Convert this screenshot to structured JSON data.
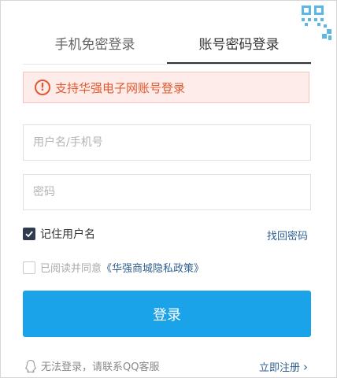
{
  "tabs": {
    "sms_login": "手机免密登录",
    "password_login": "账号密码登录"
  },
  "notice": {
    "icon": "!",
    "text": "支持华强电子网账号登录"
  },
  "form": {
    "username_placeholder": "用户名/手机号",
    "username_value": "",
    "password_placeholder": "密码",
    "password_value": "",
    "remember_label": "记住用户名",
    "forgot_link": "找回密码",
    "agree_text": "已阅读并同意",
    "agree_link": "《华强商城隐私政策》",
    "login_button": "登录"
  },
  "footer": {
    "help_text": "无法登录，请联系QQ客服",
    "register_link": "立即注册",
    "register_arrow": "›"
  },
  "colors": {
    "primary_button": "#1aa3e8",
    "notice_text": "#e4582e",
    "notice_bg": "#fdecea",
    "link": "#2f5f8f",
    "checkbox_checked": "#2f3b4e"
  },
  "icons": {
    "qr_toggle": "qr-code-icon",
    "notice": "exclamation-circle-icon",
    "remember_checkbox": "check-icon",
    "help": "qq-icon"
  },
  "state": {
    "active_tab": "password_login",
    "remember_checked": true,
    "agree_checked": false
  }
}
